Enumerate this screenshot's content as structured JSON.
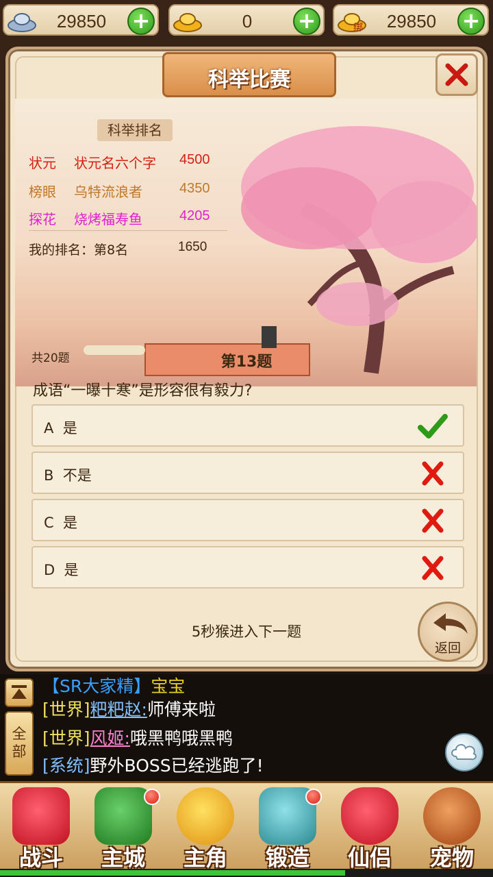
{
  "currency": [
    {
      "icon": "silver-ingot-icon",
      "value": "29850"
    },
    {
      "icon": "gold-ingot-icon",
      "value": "0"
    },
    {
      "icon": "bound-gold-ingot-icon",
      "value": "29850",
      "tag": "绑"
    }
  ],
  "panel": {
    "title": "科举比赛",
    "ranking": {
      "header": "科举排名",
      "rows": [
        {
          "title": "状元",
          "name": "状元名六个字",
          "score": "4500",
          "color": "#d81e10"
        },
        {
          "title": "榜眼",
          "name": "乌特流浪者",
          "score": "4350",
          "color": "#c07828"
        },
        {
          "title": "探花",
          "name": "烧烤福寿鱼",
          "score": "4205",
          "color": "#e020d0"
        }
      ],
      "my_rank_label": "我的排名：第8名",
      "my_score": "1650"
    },
    "total": "共20题",
    "question_number": "第13题",
    "question": "成语“一曝十寒”是形容很有毅力?",
    "options": [
      {
        "letter": "A",
        "text": "是",
        "mark": "check"
      },
      {
        "letter": "B",
        "text": "不是",
        "mark": "cross"
      },
      {
        "letter": "C",
        "text": "是",
        "mark": "cross"
      },
      {
        "letter": "D",
        "text": "是",
        "mark": "cross"
      }
    ],
    "timer": "5秒猴进入下一题",
    "back_label": "返回"
  },
  "chat": {
    "all_label": "全部",
    "lines": [
      {
        "channel": "【SR大家精】",
        "name": "宝宝",
        "text": "",
        "channel_color": "#3aa0ff",
        "name_color": "#e8d020"
      },
      {
        "channel": "[世界]",
        "name": "粑粑赵:",
        "text": "师傅来啦",
        "channel_color": "#f0e060",
        "name_color": "#80c0ff"
      },
      {
        "channel": "[世界]",
        "name": "风姬:",
        "text": "哦黑鸭哦黑鸭",
        "channel_color": "#f0e060",
        "name_color": "#ff80d0"
      },
      {
        "channel": "[系统]",
        "name": "",
        "text": "野外BOSS已经逃跑了!",
        "channel_color": "#80c0ff",
        "name_color": "#ffffff"
      }
    ]
  },
  "nav": [
    {
      "label": "战斗",
      "icon": "battle-icon",
      "color": "#e02838",
      "badge": false
    },
    {
      "label": "主城",
      "icon": "city-icon",
      "color": "#3a9a3a",
      "badge": true
    },
    {
      "label": "主角",
      "icon": "hero-icon",
      "color": "#f0b020",
      "badge": false
    },
    {
      "label": "锻造",
      "icon": "hammer-icon",
      "color": "#40a8b0",
      "badge": true
    },
    {
      "label": "仙侣",
      "icon": "heart-icon",
      "color": "#e02030",
      "badge": false
    },
    {
      "label": "宠物",
      "icon": "monkey-icon",
      "color": "#d06020",
      "badge": false
    }
  ],
  "progress": 0.7
}
